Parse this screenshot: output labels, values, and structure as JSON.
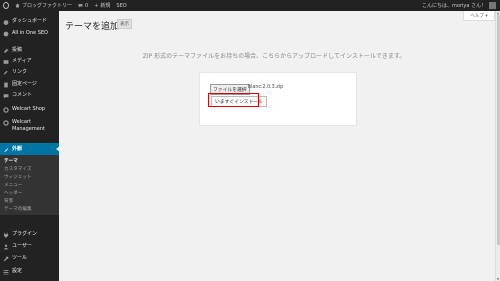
{
  "admin_bar": {
    "site_name": "ブロッグファクトリー",
    "comments_count": "0",
    "new_label": "新規",
    "seo_label": "SEO",
    "greeting": "こんにちは、moriya さん！"
  },
  "sidebar": {
    "items": [
      {
        "label": "ダッシュボード",
        "icon": "dashboard-icon"
      },
      {
        "label": "All in One SEO",
        "icon": "seo-icon"
      },
      {
        "label": "投稿",
        "icon": "pin-icon"
      },
      {
        "label": "メディア",
        "icon": "media-icon"
      },
      {
        "label": "リンク",
        "icon": "link-icon"
      },
      {
        "label": "固定ページ",
        "icon": "page-icon"
      },
      {
        "label": "コメント",
        "icon": "comment-icon"
      },
      {
        "label": "Welcart Shop",
        "icon": "gear-icon"
      },
      {
        "label": "Welcart Management",
        "icon": "gear-icon"
      },
      {
        "label": "外観",
        "icon": "brush-icon"
      },
      {
        "label": "プラグイン",
        "icon": "plugin-icon"
      },
      {
        "label": "ユーザー",
        "icon": "user-icon"
      },
      {
        "label": "ツール",
        "icon": "wrench-icon"
      },
      {
        "label": "設定",
        "icon": "settings-icon"
      }
    ],
    "submenu": [
      "テーマ",
      "カスタマイズ",
      "ウィジェット",
      "メニュー",
      "ヘッダー",
      "背景",
      "テーマの編集"
    ]
  },
  "main": {
    "title": "テーマを追加",
    "title_button": "表示",
    "help_tab": "ヘルプ ▾",
    "upload_message": "ZIP 形式のテーマファイルをお持ちの場合、こちらからアップロードしてインストールできます。",
    "file_button": "ファイルを選択",
    "file_name": "blanc.2.0.3.zip",
    "install_button": "いますぐインストール"
  },
  "colors": {
    "admin_bar": "#222222",
    "sidebar": "#222222",
    "active_menu": "#0074a2",
    "highlight": "#dd0000",
    "background": "#f1f1f1"
  }
}
